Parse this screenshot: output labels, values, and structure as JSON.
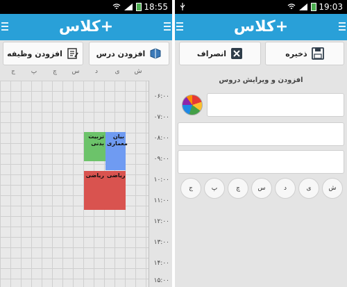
{
  "left": {
    "status_time": "18:55",
    "logo": "کلاس+",
    "buttons": {
      "add_homework": "افزودن وظیفه",
      "add_class": "افزودن درس"
    },
    "days": [
      "ش",
      "ی",
      "د",
      "س",
      "چ",
      "پ",
      "ج"
    ],
    "times": [
      "۰۶:۰۰",
      "۰۷:۰۰",
      "۰۸:۰۰",
      "۰۹:۰۰",
      "۱۰:۰۰",
      "۱۱:۰۰",
      "۱۲:۰۰",
      "۱۳:۰۰",
      "۱۴:۰۰",
      "۱۵:۰۰"
    ],
    "classes": [
      {
        "label": "تربیت بدنی",
        "color": "#6cc36a"
      },
      {
        "label": "بیان معماری",
        "color": "#6f9bf2"
      },
      {
        "label": "ریاضی",
        "color": "#d9534f"
      },
      {
        "label": "ریاضی",
        "color": "#d9534f"
      }
    ]
  },
  "right": {
    "status_time": "19:03",
    "logo": "کلاس+",
    "buttons": {
      "save": "ذخیره",
      "cancel": "انصراف"
    },
    "section_title": "افزودن و ویرایش دروس",
    "day_buttons": [
      "ش",
      "ی",
      "د",
      "س",
      "چ",
      "پ",
      "ج"
    ]
  },
  "colors": {
    "appbar": "#29a0d8",
    "green": "#6cc36a",
    "blue": "#6f9bf2",
    "red": "#d9534f"
  }
}
